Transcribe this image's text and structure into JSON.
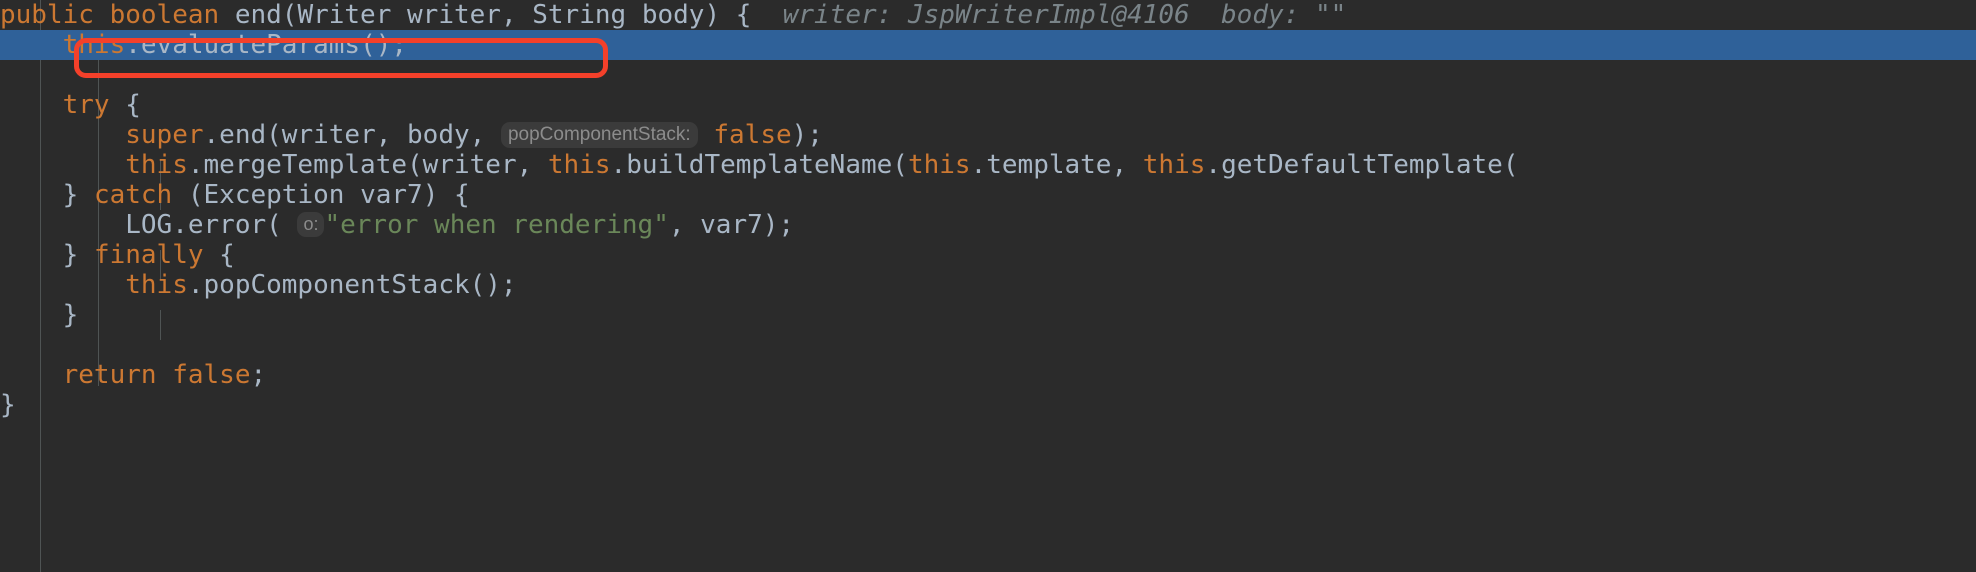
{
  "editor": {
    "theme": "darcula",
    "background": "#2b2b2b",
    "selection_color": "#2f6199",
    "keyword_color": "#cc7832",
    "identifier_color": "#a9b7c6",
    "string_color": "#6a8759",
    "hint_color": "#7a8489",
    "annotation_color": "#f4402a"
  },
  "code": {
    "lines": [
      {
        "id": "line-signature",
        "selected": false,
        "tokens": [
          {
            "type": "kw",
            "text": "public"
          },
          {
            "type": "plain",
            "text": " "
          },
          {
            "type": "kw",
            "text": "boolean"
          },
          {
            "type": "plain",
            "text": " "
          },
          {
            "type": "ident",
            "text": "end"
          },
          {
            "type": "punct",
            "text": "("
          },
          {
            "type": "ident",
            "text": "Writer writer"
          },
          {
            "type": "punct",
            "text": ", "
          },
          {
            "type": "ident",
            "text": "String body"
          },
          {
            "type": "punct",
            "text": ") {"
          },
          {
            "type": "plain",
            "text": "  "
          },
          {
            "type": "hint",
            "text": "writer: JspWriterImpl@4106"
          },
          {
            "type": "plain",
            "text": "  "
          },
          {
            "type": "hint",
            "text": "body: \"\""
          }
        ]
      },
      {
        "id": "line-evaluate-params",
        "selected": true,
        "tokens": [
          {
            "type": "plain",
            "text": "    "
          },
          {
            "type": "kw",
            "text": "this"
          },
          {
            "type": "punct",
            "text": "."
          },
          {
            "type": "ident",
            "text": "evaluateParams"
          },
          {
            "type": "punct",
            "text": "();"
          }
        ]
      },
      {
        "id": "line-blank-1",
        "selected": false,
        "tokens": []
      },
      {
        "id": "line-try",
        "selected": false,
        "tokens": [
          {
            "type": "plain",
            "text": "    "
          },
          {
            "type": "kw",
            "text": "try"
          },
          {
            "type": "plain",
            "text": " "
          },
          {
            "type": "punct",
            "text": "{"
          }
        ]
      },
      {
        "id": "line-super-end",
        "selected": false,
        "tokens": [
          {
            "type": "plain",
            "text": "        "
          },
          {
            "type": "kw",
            "text": "super"
          },
          {
            "type": "punct",
            "text": "."
          },
          {
            "type": "ident",
            "text": "end"
          },
          {
            "type": "punct",
            "text": "("
          },
          {
            "type": "ident",
            "text": "writer"
          },
          {
            "type": "punct",
            "text": ", "
          },
          {
            "type": "ident",
            "text": "body"
          },
          {
            "type": "punct",
            "text": ", "
          },
          {
            "type": "pill",
            "text": "popComponentStack:"
          },
          {
            "type": "plain",
            "text": " "
          },
          {
            "type": "kw",
            "text": "false"
          },
          {
            "type": "punct",
            "text": ");"
          }
        ]
      },
      {
        "id": "line-merge-template",
        "selected": false,
        "tokens": [
          {
            "type": "plain",
            "text": "        "
          },
          {
            "type": "kw",
            "text": "this"
          },
          {
            "type": "punct",
            "text": "."
          },
          {
            "type": "ident",
            "text": "mergeTemplate"
          },
          {
            "type": "punct",
            "text": "("
          },
          {
            "type": "ident",
            "text": "writer"
          },
          {
            "type": "punct",
            "text": ", "
          },
          {
            "type": "kw",
            "text": "this"
          },
          {
            "type": "punct",
            "text": "."
          },
          {
            "type": "ident",
            "text": "buildTemplateName"
          },
          {
            "type": "punct",
            "text": "("
          },
          {
            "type": "kw",
            "text": "this"
          },
          {
            "type": "punct",
            "text": "."
          },
          {
            "type": "ident",
            "text": "template"
          },
          {
            "type": "punct",
            "text": ", "
          },
          {
            "type": "kw",
            "text": "this"
          },
          {
            "type": "punct",
            "text": "."
          },
          {
            "type": "ident",
            "text": "getDefaultTemplate"
          },
          {
            "type": "punct",
            "text": "("
          }
        ]
      },
      {
        "id": "line-catch",
        "selected": false,
        "tokens": [
          {
            "type": "plain",
            "text": "    "
          },
          {
            "type": "punct",
            "text": "} "
          },
          {
            "type": "kw",
            "text": "catch"
          },
          {
            "type": "plain",
            "text": " "
          },
          {
            "type": "punct",
            "text": "("
          },
          {
            "type": "ident",
            "text": "Exception var7"
          },
          {
            "type": "punct",
            "text": ") {"
          }
        ]
      },
      {
        "id": "line-log-error",
        "selected": false,
        "tokens": [
          {
            "type": "plain",
            "text": "        "
          },
          {
            "type": "ident",
            "text": "LOG"
          },
          {
            "type": "punct",
            "text": "."
          },
          {
            "type": "ident",
            "text": "error"
          },
          {
            "type": "punct",
            "text": "( "
          },
          {
            "type": "pill",
            "text": "o:"
          },
          {
            "type": "str",
            "text": "\"error when rendering\""
          },
          {
            "type": "punct",
            "text": ", "
          },
          {
            "type": "ident",
            "text": "var7"
          },
          {
            "type": "punct",
            "text": ");"
          }
        ]
      },
      {
        "id": "line-finally",
        "selected": false,
        "tokens": [
          {
            "type": "plain",
            "text": "    "
          },
          {
            "type": "punct",
            "text": "} "
          },
          {
            "type": "kw",
            "text": "finally"
          },
          {
            "type": "plain",
            "text": " "
          },
          {
            "type": "punct",
            "text": "{"
          }
        ]
      },
      {
        "id": "line-pop-component-stack",
        "selected": false,
        "tokens": [
          {
            "type": "plain",
            "text": "        "
          },
          {
            "type": "kw",
            "text": "this"
          },
          {
            "type": "punct",
            "text": "."
          },
          {
            "type": "ident",
            "text": "popComponentStack"
          },
          {
            "type": "punct",
            "text": "();"
          }
        ]
      },
      {
        "id": "line-close-try",
        "selected": false,
        "tokens": [
          {
            "type": "plain",
            "text": "    "
          },
          {
            "type": "punct",
            "text": "}"
          }
        ]
      },
      {
        "id": "line-blank-2",
        "selected": false,
        "tokens": []
      },
      {
        "id": "line-return",
        "selected": false,
        "tokens": [
          {
            "type": "plain",
            "text": "    "
          },
          {
            "type": "kw",
            "text": "return"
          },
          {
            "type": "plain",
            "text": " "
          },
          {
            "type": "kw",
            "text": "false"
          },
          {
            "type": "punct",
            "text": ";"
          }
        ]
      },
      {
        "id": "line-close-method",
        "selected": false,
        "tokens": [
          {
            "type": "punct",
            "text": "}"
          }
        ]
      }
    ]
  },
  "annotation": {
    "type": "rectangle-highlight",
    "color": "#f4402a",
    "target_line_id": "line-evaluate-params",
    "target_text": "this.evaluateParams();"
  }
}
